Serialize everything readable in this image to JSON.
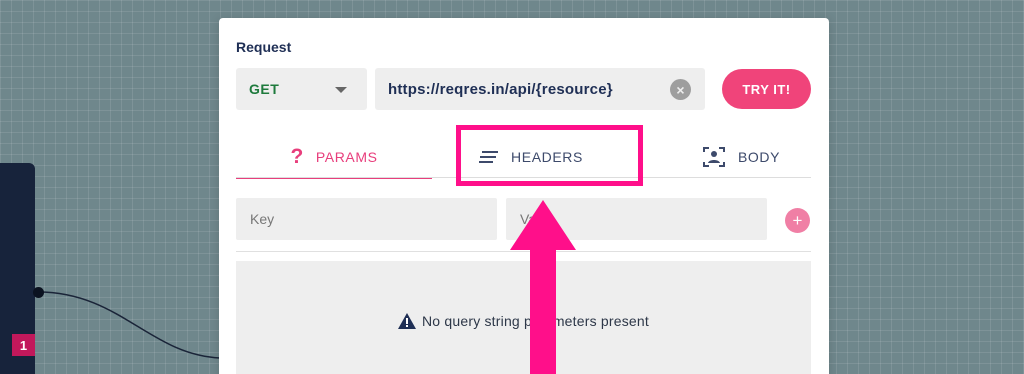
{
  "canvas": {
    "node_badge": "1"
  },
  "request": {
    "title": "Request",
    "method": "GET",
    "url": "https://reqres.in/api/{resource}",
    "try_label": "TRY IT!"
  },
  "tabs": [
    {
      "label": "PARAMS",
      "icon": "question-icon",
      "active": true
    },
    {
      "label": "HEADERS",
      "icon": "lines-icon",
      "active": false
    },
    {
      "label": "BODY",
      "icon": "user-frame-icon",
      "active": false
    }
  ],
  "params": {
    "key_placeholder": "Key",
    "value_placeholder": "Value",
    "add_label": "+",
    "empty_message": "No query string parameters present"
  },
  "colors": {
    "accent": "#e83e7c",
    "button": "#f0447a",
    "method_get": "#1e7a3c",
    "highlight": "#ff0f8a",
    "canvas_bg": "#6f878c"
  }
}
